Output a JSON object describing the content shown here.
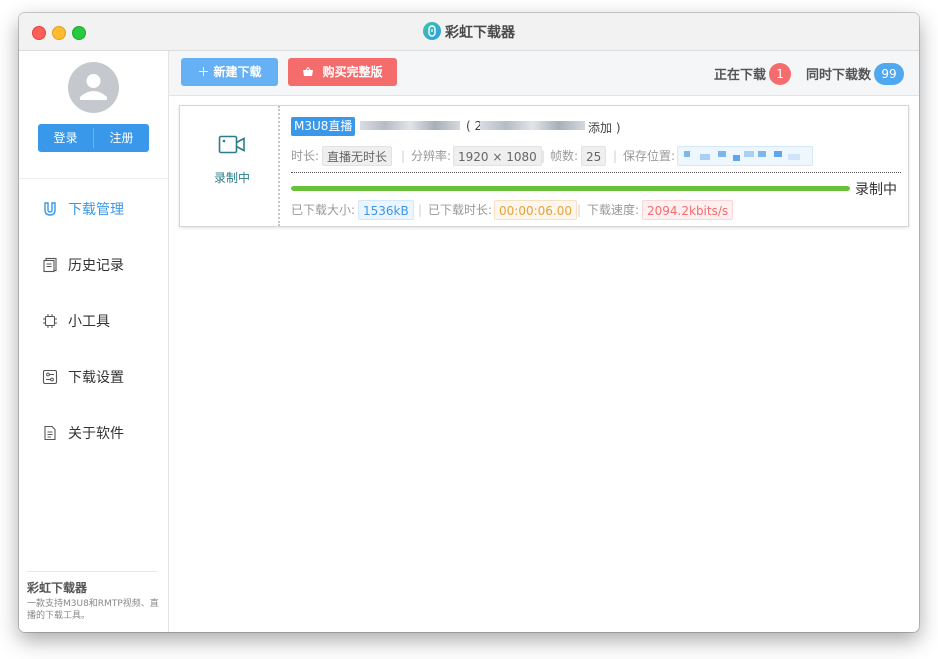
{
  "window": {
    "title": "彩虹下载器"
  },
  "sidebar": {
    "login": "登录",
    "register": "注册",
    "items": [
      {
        "label": "下载管理",
        "icon": "magnet-icon"
      },
      {
        "label": "历史记录",
        "icon": "history-icon"
      },
      {
        "label": "小工具",
        "icon": "chip-icon"
      },
      {
        "label": "下载设置",
        "icon": "settings-icon"
      },
      {
        "label": "关于软件",
        "icon": "document-icon"
      }
    ],
    "footer_title": "彩虹下载器",
    "footer_desc": "一款支持M3U8和RMTP视频、直播的下载工具。"
  },
  "toolbar": {
    "new_download": "新建下载",
    "buy_full": "购买完整版",
    "downloading_label": "正在下载",
    "downloading_count": "1",
    "concurrent_label": "同时下载数",
    "concurrent_count": "99"
  },
  "task": {
    "status_label": "录制中",
    "type_tag": "M3U8直播",
    "name_suffix": "添加 )",
    "name_mid": "( 2",
    "duration_label": "时长:",
    "duration_value": "直播无时长",
    "resolution_label": "分辨率:",
    "resolution_value": "1920 × 1080",
    "fps_label": "帧数:",
    "fps_value": "25",
    "save_label": "保存位置:",
    "progress_status": "录制中",
    "progress": 1.0,
    "size_label": "已下载大小:",
    "size_value": "1536kB",
    "time_label": "已下载时长:",
    "time_value": "00:00:06.00",
    "speed_label": "下载速度:",
    "speed_value": "2094.2kbits/s"
  },
  "colors": {
    "primary": "#3a98ea",
    "danger": "#f56c6c",
    "success": "#67c23a",
    "warning": "#e6a23c"
  }
}
